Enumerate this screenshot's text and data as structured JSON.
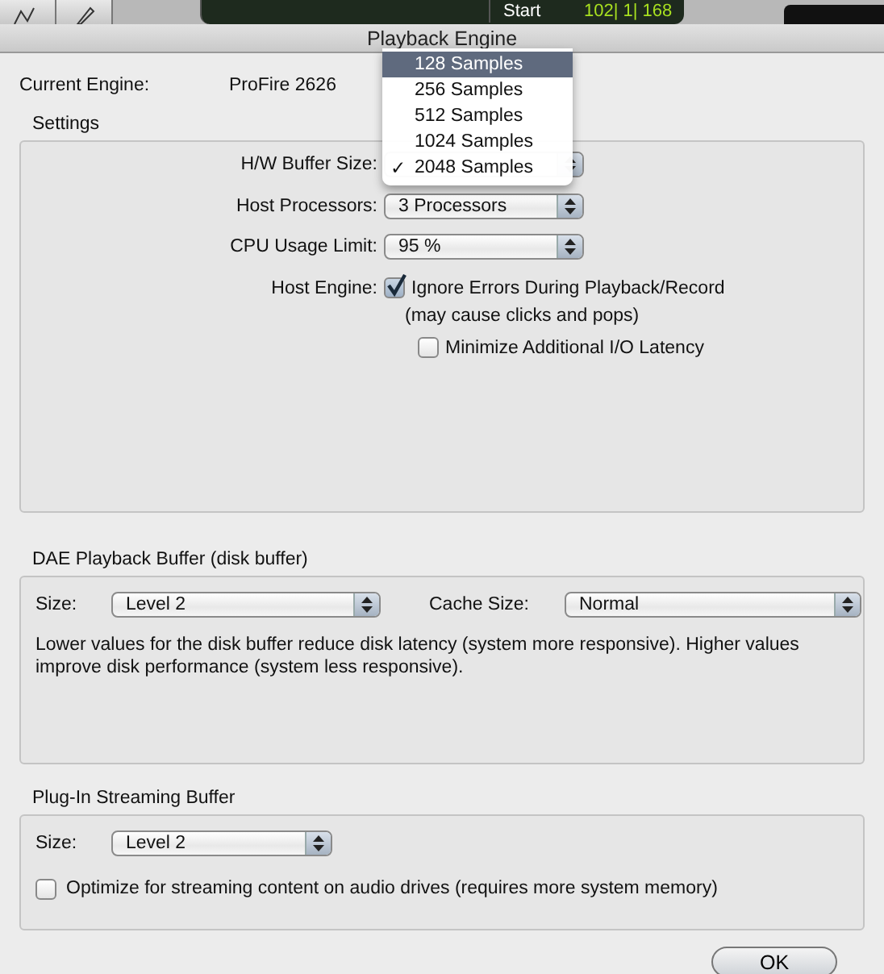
{
  "background_app": {
    "counter_label": "Start",
    "counter_value": "102| 1| 168"
  },
  "window": {
    "title": "Playback Engine"
  },
  "current_engine": {
    "label": "Current Engine:",
    "value": "ProFire 2626"
  },
  "settings": {
    "title": "Settings",
    "hw_buffer": {
      "label": "H/W Buffer Size:",
      "menu": [
        {
          "label": "128 Samples",
          "highlighted": true,
          "checked": false
        },
        {
          "label": "256 Samples",
          "highlighted": false,
          "checked": false
        },
        {
          "label": "512 Samples",
          "highlighted": false,
          "checked": false
        },
        {
          "label": "1024 Samples",
          "highlighted": false,
          "checked": false
        },
        {
          "label": "2048 Samples",
          "highlighted": false,
          "checked": true
        }
      ],
      "check_mark": "✓"
    },
    "popups": [
      {
        "label": "Host Processors:",
        "value": "3 Processors"
      },
      {
        "label": "CPU Usage Limit:",
        "value": "95 %"
      }
    ],
    "host_engine": {
      "label": "Host Engine:",
      "ignore_errors": {
        "label": "Ignore Errors During Playback/Record",
        "checked": true
      },
      "note": "(may cause clicks and pops)",
      "minimize_latency": {
        "label": "Minimize Additional I/O Latency",
        "checked": false
      }
    }
  },
  "dae_buffer": {
    "title": "DAE Playback Buffer (disk buffer)",
    "size": {
      "label": "Size:",
      "value": "Level 2"
    },
    "cache_size": {
      "label": "Cache Size:",
      "value": "Normal"
    },
    "description": "Lower values for the disk buffer reduce disk latency (system more responsive).  Higher values improve disk performance (system less responsive)."
  },
  "plugin_buffer": {
    "title": "Plug-In Streaming Buffer",
    "size": {
      "label": "Size:",
      "value": "Level 2"
    },
    "optimize": {
      "label": "Optimize for streaming content on audio drives (requires more system memory)",
      "checked": false
    }
  },
  "buttons": [
    {
      "label": "OK"
    }
  ]
}
